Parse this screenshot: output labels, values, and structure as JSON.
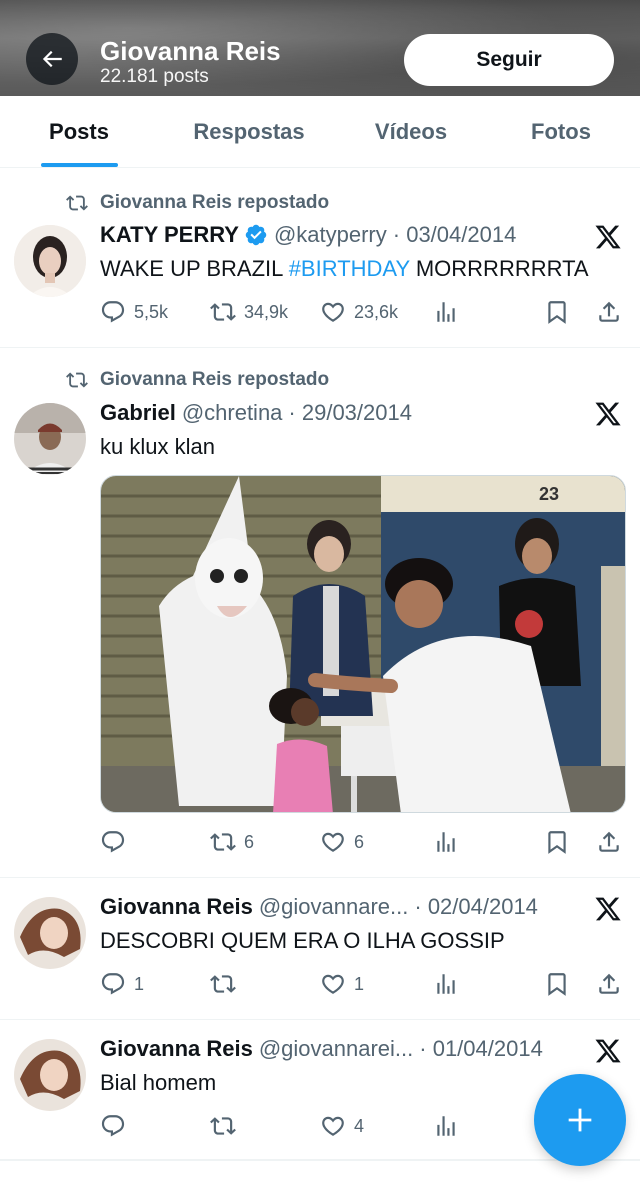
{
  "header": {
    "name": "Giovanna Reis",
    "posts_count": "22.181 posts",
    "follow_label": "Seguir"
  },
  "tabs": [
    {
      "label": "Posts",
      "active": true
    },
    {
      "label": "Respostas",
      "active": false
    },
    {
      "label": "Vídeos",
      "active": false
    },
    {
      "label": "Fotos",
      "active": false
    }
  ],
  "tweets": [
    {
      "repost_label": "Giovanna Reis repostado",
      "name": "KATY PERRY",
      "verified": true,
      "handle": "@katyperry",
      "date": "· 03/04/2014",
      "text_before": "WAKE UP BRAZIL ",
      "hashtag": "#BIRTHDAY",
      "text_after": " MORRRRRRRTA",
      "replies": "5,5k",
      "reposts": "34,9k",
      "likes": "23,6k"
    },
    {
      "repost_label": "Giovanna Reis repostado",
      "name": "Gabriel",
      "handle": "@chretina",
      "date": "· 29/03/2014",
      "text": "ku klux klan",
      "media_sign": "23",
      "replies": "",
      "reposts": "6",
      "likes": "6"
    },
    {
      "name": "Giovanna Reis",
      "handle": "@giovannare...",
      "date": "· 02/04/2014",
      "text": "DESCOBRI QUEM ERA O ILHA GOSSIP",
      "replies": "1",
      "reposts": "",
      "likes": "1"
    },
    {
      "name": "Giovanna Reis",
      "handle": "@giovannarei...",
      "date": "· 01/04/2014",
      "text": "Bial homem",
      "replies": "",
      "reposts": "",
      "likes": "4"
    }
  ],
  "colors": {
    "accent": "#1d9bf0",
    "text": "#0f1419",
    "secondary": "#536471"
  },
  "icons": {
    "back": "arrow-left-icon",
    "repost": "repost-icon",
    "verified": "verified-badge-icon",
    "x_logo": "x-logo-icon",
    "reply": "reply-icon",
    "like": "heart-icon",
    "views": "views-icon",
    "bookmark": "bookmark-icon",
    "share": "share-icon",
    "compose": "plus-icon"
  }
}
